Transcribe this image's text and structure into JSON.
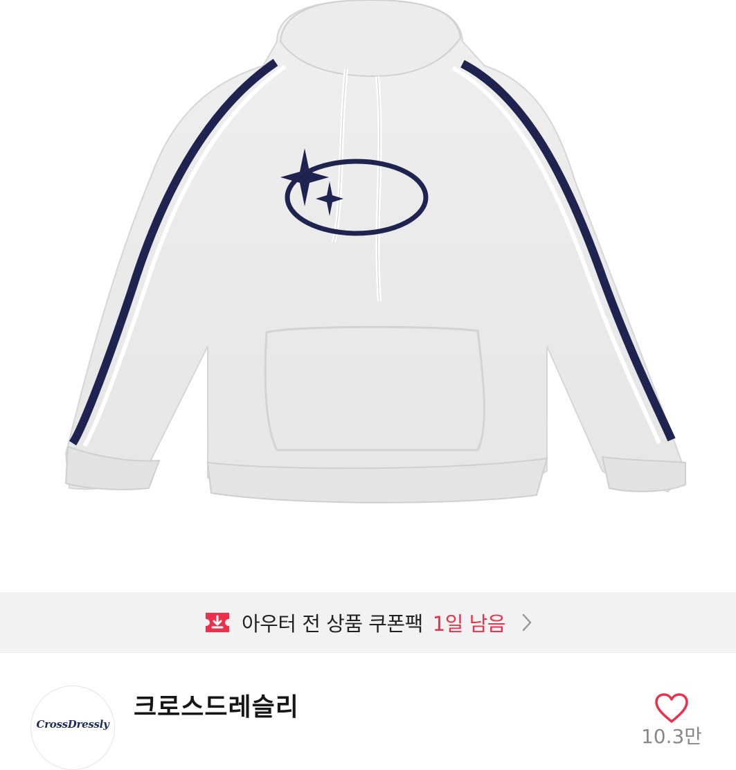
{
  "product": {
    "image_alt": "Light grey hoodie with navy sleeve stripes and star-oval logo"
  },
  "coupon": {
    "text": "아우터 전 상품 쿠폰팩",
    "highlight": "1일 남음",
    "accent_color": "#ee2f4b"
  },
  "shop": {
    "logo_text": "CrossDressly",
    "name": "크로스드레슬리",
    "like_count": "10.3만"
  },
  "icons": [
    "back-arrow-icon",
    "home-icon",
    "search-icon",
    "cart-icon",
    "coupon-download-icon",
    "chevron-right-icon",
    "heart-icon"
  ]
}
